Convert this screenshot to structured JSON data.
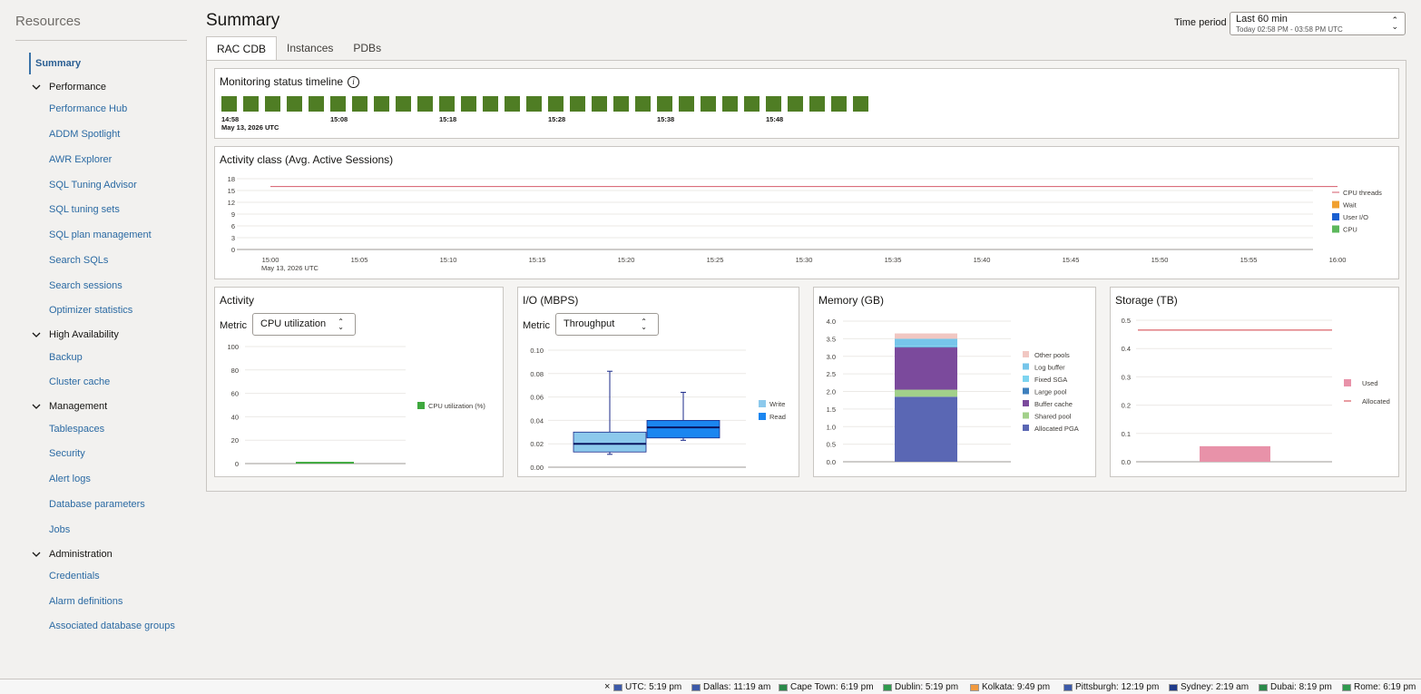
{
  "sidebar": {
    "title": "Resources",
    "summary": "Summary",
    "groups": [
      {
        "label": "Performance",
        "items": [
          "Performance Hub",
          "ADDM Spotlight",
          "AWR Explorer",
          "SQL Tuning Advisor",
          "SQL tuning sets",
          "SQL plan management",
          "Search SQLs",
          "Search sessions",
          "Optimizer statistics"
        ]
      },
      {
        "label": "High Availability",
        "items": [
          "Backup",
          "Cluster cache"
        ]
      },
      {
        "label": "Management",
        "items": [
          "Tablespaces",
          "Security",
          "Alert logs",
          "Database parameters",
          "Jobs"
        ]
      },
      {
        "label": "Administration",
        "items": [
          "Credentials",
          "Alarm definitions",
          "Associated database groups"
        ]
      }
    ]
  },
  "header": {
    "title": "Summary",
    "time_period_label": "Time period",
    "time_period_value": "Last 60 min",
    "time_period_range": "Today 02:58 PM - 03:58 PM UTC"
  },
  "tabs": [
    "RAC CDB",
    "Instances",
    "PDBs"
  ],
  "timeline": {
    "title": "Monitoring status timeline",
    "block_count": 30,
    "block_color": "#4f7d24",
    "date_label": "May 13, 2026 UTC",
    "ticks": [
      "14:58",
      "15:08",
      "15:18",
      "15:28",
      "15:38",
      "15:48"
    ]
  },
  "activity_class": {
    "title": "Activity class (Avg. Active Sessions)",
    "date_label": "May 13, 2026 UTC"
  },
  "activity": {
    "title": "Activity",
    "metric_label": "Metric",
    "metric_value": "CPU utilization"
  },
  "io": {
    "title": "I/O (MBPS)",
    "metric_label": "Metric",
    "metric_value": "Throughput"
  },
  "memory": {
    "title": "Memory (GB)"
  },
  "storage": {
    "title": "Storage (TB)"
  },
  "chart_data": [
    {
      "id": "activity_class",
      "type": "line",
      "x": [
        "15:00",
        "15:05",
        "15:10",
        "15:15",
        "15:20",
        "15:25",
        "15:30",
        "15:35",
        "15:40",
        "15:45",
        "15:50",
        "15:55",
        "16:00"
      ],
      "ylim": [
        0,
        18
      ],
      "yticks": [
        0,
        3,
        6,
        9,
        12,
        15,
        18
      ],
      "series": [
        {
          "name": "CPU threads",
          "color": "#d45a6a",
          "type": "line",
          "value": 16
        },
        {
          "name": "Wait",
          "color": "#f0a030",
          "type": "area",
          "value": 0
        },
        {
          "name": "User I/O",
          "color": "#1a5fd0",
          "type": "area",
          "value": 0
        },
        {
          "name": "CPU",
          "color": "#5cb85c",
          "type": "area",
          "value": 0
        }
      ],
      "legend": "right"
    },
    {
      "id": "activity",
      "type": "bar",
      "ylim": [
        0,
        100
      ],
      "yticks": [
        0,
        20,
        40,
        60,
        80,
        100
      ],
      "series": [
        {
          "name": "CPU utilization (%)",
          "color": "#3ea83e",
          "values": [
            1.5
          ]
        }
      ],
      "legend": "right"
    },
    {
      "id": "io",
      "type": "box",
      "ylim": [
        0,
        0.1
      ],
      "yticks": [
        "0.00",
        "0.02",
        "0.04",
        "0.06",
        "0.08",
        "0.10"
      ],
      "series": [
        {
          "name": "Write",
          "color": "#8cc9ec",
          "min": 0.011,
          "q1": 0.013,
          "median": 0.02,
          "q3": 0.03,
          "max": 0.082
        },
        {
          "name": "Read",
          "color": "#1b86f0",
          "min": 0.023,
          "q1": 0.025,
          "median": 0.034,
          "q3": 0.04,
          "max": 0.064
        }
      ],
      "legend": "right"
    },
    {
      "id": "memory",
      "type": "bar",
      "stacked": true,
      "ylim": [
        0,
        4
      ],
      "yticks": [
        "0.0",
        "0.5",
        "1.0",
        "1.5",
        "2.0",
        "2.5",
        "3.0",
        "3.5",
        "4.0"
      ],
      "series": [
        {
          "name": "Other pools",
          "color": "#f1c7c2",
          "value": 0.15
        },
        {
          "name": "Log buffer",
          "color": "#76c5ea",
          "value": 0.2
        },
        {
          "name": "Fixed SGA",
          "color": "#7dd4f0",
          "value": 0.03
        },
        {
          "name": "Large pool",
          "color": "#3d7fbd",
          "value": 0.02
        },
        {
          "name": "Buffer cache",
          "color": "#7b4a9c",
          "value": 1.2
        },
        {
          "name": "Shared pool",
          "color": "#a2d08a",
          "value": 0.2
        },
        {
          "name": "Allocated PGA",
          "color": "#5a67b4",
          "value": 1.85
        }
      ],
      "legend": "right"
    },
    {
      "id": "storage",
      "type": "bar",
      "ylim": [
        0,
        0.5
      ],
      "yticks": [
        "0.0",
        "0.1",
        "0.2",
        "0.3",
        "0.4",
        "0.5"
      ],
      "series": [
        {
          "name": "Used",
          "color": "#e892a9",
          "type": "bar",
          "value": 0.055
        },
        {
          "name": "Allocated",
          "color": "#d23b44",
          "type": "line",
          "value": 0.465
        }
      ],
      "legend": "right"
    }
  ],
  "footer": {
    "close": "×",
    "timezones": [
      {
        "label": "UTC: 5:19 pm",
        "flag": "#3c5aa8"
      },
      {
        "label": "Dallas: 11:19 am",
        "flag": "#3c5aa8"
      },
      {
        "label": "Cape Town: 6:19 pm",
        "flag": "#2a8a4a"
      },
      {
        "label": "Dublin: 5:19 pm",
        "flag": "#2f9a4e"
      },
      {
        "label": "Kolkata: 9:49 pm",
        "flag": "#f19a3e"
      },
      {
        "label": "Pittsburgh: 12:19 pm",
        "flag": "#3c5aa8"
      },
      {
        "label": "Sydney: 2:19 am",
        "flag": "#1f3a8a"
      },
      {
        "label": "Dubai: 8:19 pm",
        "flag": "#2a8a4a"
      },
      {
        "label": "Rome: 6:19 pm",
        "flag": "#2f9a4e"
      }
    ]
  }
}
